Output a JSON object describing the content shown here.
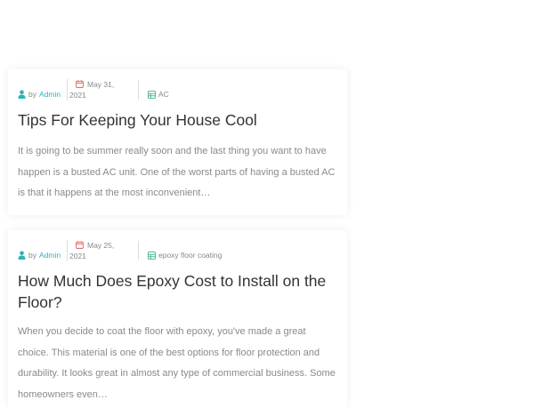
{
  "colors": {
    "accent": "#2bb3c0",
    "date_icon": "#e05a5a",
    "category_icon": "#3fb27f"
  },
  "posts": [
    {
      "author_prefix": "by",
      "author": "Admin",
      "date_line1": "May 31,",
      "date_line2": "2021",
      "category": "AC",
      "title": "Tips For Keeping Your House Cool",
      "excerpt": "It is going to be summer really soon and the last thing you want to have happen is a busted AC unit.  One of the worst parts of having a busted AC is that it happens at the most inconvenient…"
    },
    {
      "author_prefix": "by",
      "author": "Admin",
      "date_line1": "May 25,",
      "date_line2": "2021",
      "category": "epoxy floor coating",
      "title": "How Much Does Epoxy Cost to Install on the Floor?",
      "excerpt": "When you decide to coat the floor with epoxy, you've made a great choice. This material is one of the best options for floor protection and durability. It looks great in almost any type of commercial business. Some homeowners even…"
    }
  ]
}
